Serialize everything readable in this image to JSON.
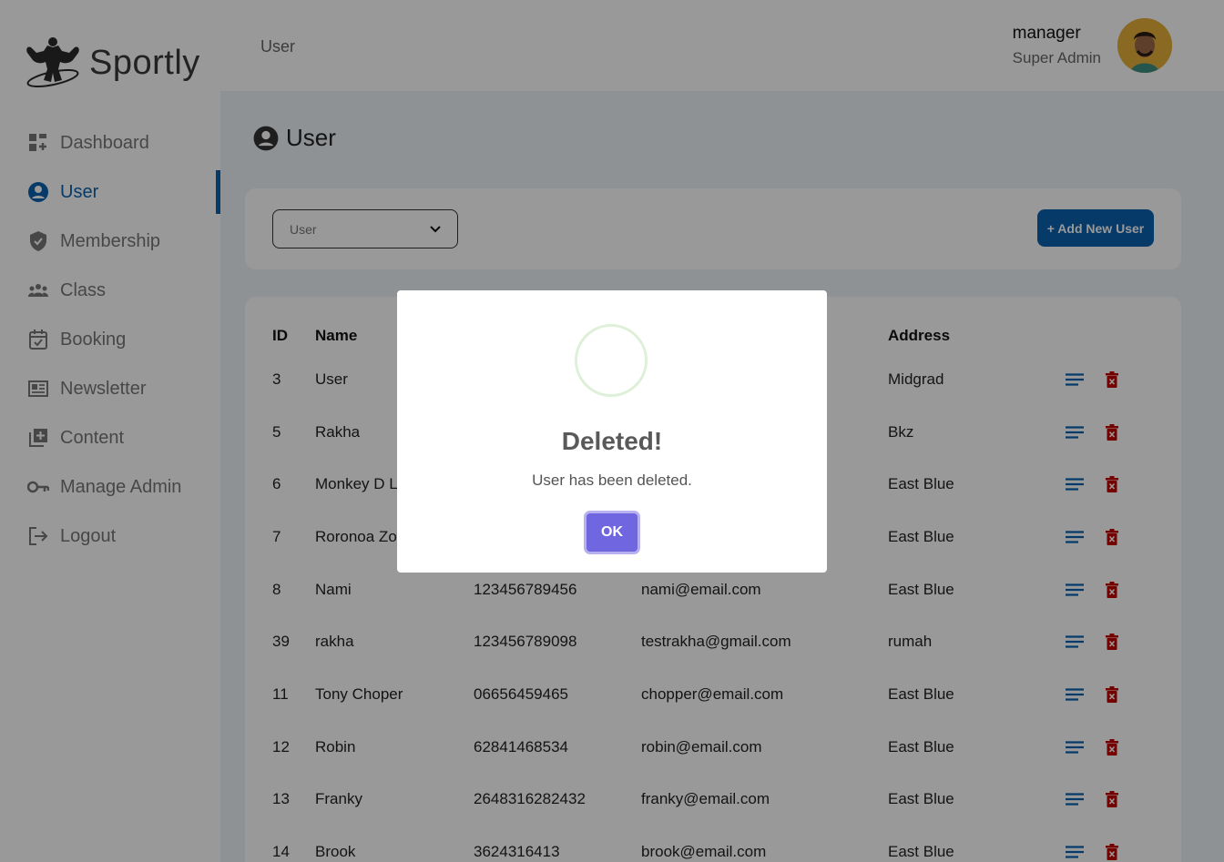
{
  "brand": {
    "name": "Sportly"
  },
  "sidebar": {
    "items": [
      {
        "label": "Dashboard",
        "icon": "dashboard-icon"
      },
      {
        "label": "User",
        "icon": "user-circle-icon",
        "active": true
      },
      {
        "label": "Membership",
        "icon": "shield-check-icon"
      },
      {
        "label": "Class",
        "icon": "group-icon"
      },
      {
        "label": "Booking",
        "icon": "calendar-check-icon"
      },
      {
        "label": "Newsletter",
        "icon": "newspaper-icon"
      },
      {
        "label": "Content",
        "icon": "library-add-icon"
      },
      {
        "label": "Manage Admin",
        "icon": "key-icon"
      },
      {
        "label": "Logout",
        "icon": "logout-icon"
      }
    ]
  },
  "header": {
    "breadcrumb": "User",
    "user_name": "manager",
    "user_role": "Super Admin"
  },
  "page": {
    "title": "User"
  },
  "filter": {
    "select_value": "User",
    "add_button": "+ Add New User"
  },
  "table": {
    "columns": {
      "id": "ID",
      "name": "Name",
      "address": "Address"
    },
    "rows": [
      {
        "id": "3",
        "name": "User",
        "phone": "",
        "email": "",
        "address": "Midgrad"
      },
      {
        "id": "5",
        "name": "Rakha",
        "phone": "",
        "email": "",
        "address": "Bkz"
      },
      {
        "id": "6",
        "name": "Monkey D L",
        "phone": "",
        "email": "",
        "address": "East Blue"
      },
      {
        "id": "7",
        "name": "Roronoa Zor",
        "phone": "",
        "email": "",
        "address": "East Blue"
      },
      {
        "id": "8",
        "name": "Nami",
        "phone": "123456789456",
        "email": "nami@email.com",
        "address": "East Blue"
      },
      {
        "id": "39",
        "name": "rakha",
        "phone": "123456789098",
        "email": "testrakha@gmail.com",
        "address": "rumah"
      },
      {
        "id": "11",
        "name": "Tony Choper",
        "phone": "06656459465",
        "email": "chopper@email.com",
        "address": "East Blue"
      },
      {
        "id": "12",
        "name": "Robin",
        "phone": "62841468534",
        "email": "robin@email.com",
        "address": "East Blue"
      },
      {
        "id": "13",
        "name": "Franky",
        "phone": "2648316282432",
        "email": "franky@email.com",
        "address": "East Blue"
      },
      {
        "id": "14",
        "name": "Brook",
        "phone": "3624316413",
        "email": "brook@email.com",
        "address": "East Blue"
      }
    ]
  },
  "modal": {
    "title": "Deleted!",
    "text": "User has been deleted.",
    "ok_label": "OK"
  },
  "colors": {
    "primary": "#0b62b0",
    "danger": "#c40000",
    "modal_button": "#7066e0",
    "success_ring": "#dff0d8"
  }
}
